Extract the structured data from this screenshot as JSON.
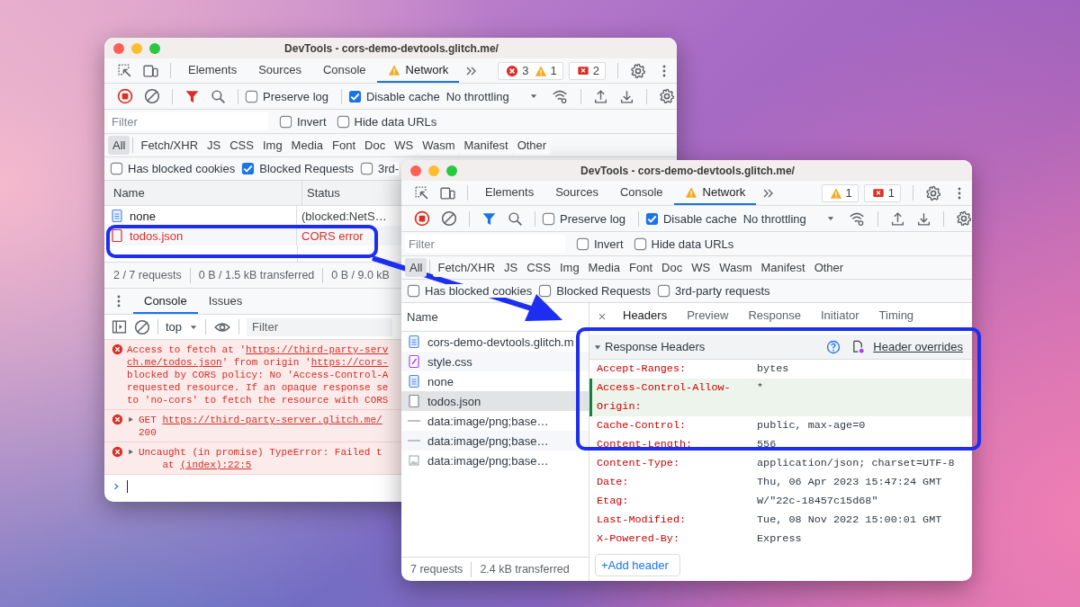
{
  "back_window": {
    "title": "DevTools - cors-demo-devtools.glitch.me/",
    "tabs": [
      {
        "label": "Elements",
        "selected": false,
        "warning": false
      },
      {
        "label": "Sources",
        "selected": false,
        "warning": false
      },
      {
        "label": "Console",
        "selected": false,
        "warning": false
      },
      {
        "label": "Network",
        "selected": true,
        "warning": true
      }
    ],
    "badge_groups": [
      [
        {
          "kind": "error",
          "count": "3"
        },
        {
          "kind": "warning",
          "count": "1"
        }
      ],
      [
        {
          "kind": "issue",
          "count": "2"
        }
      ]
    ],
    "toolbar": {
      "filter_active": true,
      "checkboxes": [
        {
          "label": "Preserve log",
          "checked": false
        },
        {
          "label": "Disable cache",
          "checked": true
        }
      ],
      "throttling": "No throttling"
    },
    "filter": {
      "placeholder": "Filter",
      "checkboxes": [
        {
          "label": "Invert",
          "checked": false
        },
        {
          "label": "Hide data URLs",
          "checked": false
        }
      ]
    },
    "type_filters": [
      {
        "label": "All",
        "selected": true
      },
      {
        "label": "Fetch/XHR",
        "selected": false
      },
      {
        "label": "JS",
        "selected": false
      },
      {
        "label": "CSS",
        "selected": false
      },
      {
        "label": "Img",
        "selected": false
      },
      {
        "label": "Media",
        "selected": false
      },
      {
        "label": "Font",
        "selected": false
      },
      {
        "label": "Doc",
        "selected": false
      },
      {
        "label": "WS",
        "selected": false
      },
      {
        "label": "Wasm",
        "selected": false
      },
      {
        "label": "Manifest",
        "selected": false
      },
      {
        "label": "Other",
        "selected": false
      }
    ],
    "request_filters": [
      {
        "label": "Has blocked cookies",
        "checked": false
      },
      {
        "label": "Blocked Requests",
        "checked": true
      },
      {
        "label": "3rd-",
        "checked": false
      }
    ],
    "columns": [
      "Name",
      "Status"
    ],
    "rows": [
      {
        "name": "none",
        "status": "(blocked:NetS…",
        "kind": "document",
        "error": false
      },
      {
        "name": "todos.json",
        "status": "CORS error",
        "kind": "fetch",
        "error": true
      }
    ],
    "summary": [
      "2 / 7 requests",
      "0 B / 1.5 kB transferred",
      "0 B / 9.0 kB"
    ],
    "drawer_tabs": [
      {
        "label": "Console",
        "selected": true
      },
      {
        "label": "Issues",
        "selected": false
      }
    ],
    "console_context": "top",
    "console_filter": {
      "placeholder": "Filter"
    },
    "messages": [
      {
        "expandable": false,
        "lines": [
          [
            {
              "text": "Access to fetch at '",
              "link": false
            },
            {
              "text": "https://third-party-serv",
              "link": true
            }
          ],
          [
            {
              "text": "ch.me/todos.json",
              "link": true
            },
            {
              "text": "' from origin '",
              "link": false
            },
            {
              "text": "https://cors-",
              "link": true
            }
          ],
          [
            {
              "text": "blocked by CORS policy: No 'Access-Control-A",
              "link": false
            }
          ],
          [
            {
              "text": "requested resource. If an opaque response se",
              "link": false
            }
          ],
          [
            {
              "text": "to 'no-cors' to fetch the resource with CORS",
              "link": false
            }
          ]
        ]
      },
      {
        "expandable": true,
        "lines": [
          [
            {
              "text": "GET ",
              "link": false
            },
            {
              "text": "https://third-party-server.glitch.me/",
              "link": true
            }
          ],
          [
            {
              "text": "200",
              "link": false
            }
          ]
        ]
      },
      {
        "expandable": true,
        "lines": [
          [
            {
              "text": "Uncaught (in promise) TypeError: Failed t",
              "link": false
            }
          ],
          [
            {
              "text": "    at ",
              "link": false
            },
            {
              "text": "(index):22:5",
              "link": true
            }
          ]
        ]
      }
    ]
  },
  "front_window": {
    "title": "DevTools - cors-demo-devtools.glitch.me/",
    "tabs": [
      {
        "label": "Elements",
        "selected": false,
        "warning": false
      },
      {
        "label": "Sources",
        "selected": false,
        "warning": false
      },
      {
        "label": "Console",
        "selected": false,
        "warning": false
      },
      {
        "label": "Network",
        "selected": true,
        "warning": true
      }
    ],
    "badge_groups": [
      [
        {
          "kind": "warning",
          "count": "1"
        }
      ],
      [
        {
          "kind": "issue",
          "count": "1"
        }
      ]
    ],
    "toolbar": {
      "filter_active": false,
      "checkboxes": [
        {
          "label": "Preserve log",
          "checked": false
        },
        {
          "label": "Disable cache",
          "checked": true
        }
      ],
      "throttling": "No throttling"
    },
    "filter": {
      "placeholder": "Filter",
      "checkboxes": [
        {
          "label": "Invert",
          "checked": false
        },
        {
          "label": "Hide data URLs",
          "checked": false
        }
      ]
    },
    "type_filters": [
      {
        "label": "All",
        "selected": true
      },
      {
        "label": "Fetch/XHR",
        "selected": false
      },
      {
        "label": "JS",
        "selected": false
      },
      {
        "label": "CSS",
        "selected": false
      },
      {
        "label": "Img",
        "selected": false
      },
      {
        "label": "Media",
        "selected": false
      },
      {
        "label": "Font",
        "selected": false
      },
      {
        "label": "Doc",
        "selected": false
      },
      {
        "label": "WS",
        "selected": false
      },
      {
        "label": "Wasm",
        "selected": false
      },
      {
        "label": "Manifest",
        "selected": false
      },
      {
        "label": "Other",
        "selected": false
      }
    ],
    "request_filters": [
      {
        "label": "Has blocked cookies",
        "checked": false
      },
      {
        "label": "Blocked Requests",
        "checked": false
      },
      {
        "label": "3rd-party requests",
        "checked": false
      }
    ],
    "name_column": "Name",
    "requests": [
      {
        "name": "cors-demo-devtools.glitch.m",
        "kind": "document",
        "selected": false
      },
      {
        "name": "style.css",
        "kind": "stylesheet",
        "selected": false
      },
      {
        "name": "none",
        "kind": "document",
        "selected": false
      },
      {
        "name": "todos.json",
        "kind": "fetch",
        "selected": true
      },
      {
        "name": "data:image/png;base…",
        "kind": "dash",
        "selected": false
      },
      {
        "name": "data:image/png;base…",
        "kind": "dash",
        "selected": false
      },
      {
        "name": "data:image/png;base…",
        "kind": "image",
        "selected": false
      }
    ],
    "summary": [
      "7 requests",
      "2.4 kB transferred"
    ],
    "detail_tabs": [
      {
        "label": "Headers",
        "selected": true
      },
      {
        "label": "Preview",
        "selected": false
      },
      {
        "label": "Response",
        "selected": false
      },
      {
        "label": "Initiator",
        "selected": false
      },
      {
        "label": "Timing",
        "selected": false
      }
    ],
    "section": {
      "title": "Response Headers",
      "expanded": true,
      "link": "Header overrides"
    },
    "headers": [
      {
        "name": "Accept-Ranges:",
        "value": "bytes",
        "overridden": false
      },
      {
        "name": "Access-Control-Allow-Origin:",
        "value": "*",
        "overridden": true
      },
      {
        "name": "Cache-Control:",
        "value": "public, max-age=0",
        "overridden": false
      },
      {
        "name": "Content-Length:",
        "value": "556",
        "overridden": false
      },
      {
        "name": "Content-Type:",
        "value": "application/json; charset=UTF-8",
        "overridden": false
      },
      {
        "name": "Date:",
        "value": "Thu, 06 Apr 2023 15:47:24 GMT",
        "overridden": false
      },
      {
        "name": "Etag:",
        "value": "W/\"22c-18457c15d68\"",
        "overridden": false
      },
      {
        "name": "Last-Modified:",
        "value": "Tue, 08 Nov 2022 15:00:01 GMT",
        "overridden": false
      },
      {
        "name": "X-Powered-By:",
        "value": "Express",
        "overridden": false
      }
    ],
    "add_header": "+Add header"
  }
}
